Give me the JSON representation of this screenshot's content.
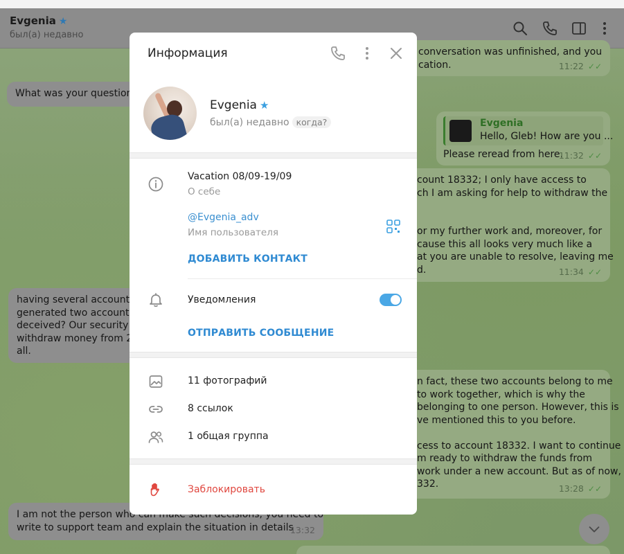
{
  "chat": {
    "contact_name": "Evgenia",
    "contact_status": "был(а) недавно",
    "messages": [
      {
        "lines": [
          "conversation was unfinished, and you",
          "cation."
        ],
        "time": "11:22"
      },
      {
        "lines": [
          "What was your question?"
        ]
      },
      {
        "reply_name": "Evgenia",
        "reply_text": "Hello, Gleb! How are you ...",
        "lines": [
          "Please reread from here."
        ],
        "time": "11:32"
      },
      {
        "lines": [
          "count 18332; I only have access to",
          "ch I am asking for help to withdraw the",
          "",
          "",
          "or my further work and, moreover, for",
          "cause this all looks very much like a",
          "at you are unable to resolve, leaving me",
          "d."
        ],
        "time": "11:34"
      },
      {
        "lines": [
          "having several accounts is",
          "generated two accounts a",
          "deceived? Our security tea",
          "withdraw money from 274",
          "all."
        ]
      },
      {
        "lines": [
          "n fact, these two accounts belong to me",
          "to work together, which is why the",
          "belonging to one person. However, this is",
          "ve mentioned this to you before.",
          "",
          "cess to account 18332. I want to continue",
          "m ready to withdraw the funds from",
          "work under a new account. But as of now,",
          "332."
        ],
        "time": "13:28"
      },
      {
        "lines": [
          "I am not the person who can make such decisions, you need to",
          "write to support team and explain the situation in details"
        ],
        "time": "13:32"
      }
    ]
  },
  "info": {
    "title": "Информация",
    "name": "Evgenia",
    "status": "был(а) недавно",
    "when_label": "когда?",
    "bio": "Vacation 08/09-19/09",
    "bio_label": "О себе",
    "username": "@Evgenia_adv",
    "username_label": "Имя пользователя",
    "add_contact": "ДОБАВИТЬ КОНТАКТ",
    "notifications_label": "Уведомления",
    "notifications_on": true,
    "send_message": "ОТПРАВИТЬ СООБЩЕНИЕ",
    "photos": "11 фотографий",
    "links": "8 ссылок",
    "groups": "1 общая группа",
    "block": "Заблокировать"
  },
  "icons": {
    "header": [
      "search-icon",
      "phone-icon",
      "sidebar-toggle-icon",
      "more-vertical-icon"
    ],
    "modal_header": [
      "phone-icon",
      "more-vertical-icon",
      "close-icon"
    ],
    "rows": [
      "info-icon",
      "bell-icon",
      "image-icon",
      "link-icon",
      "users-icon",
      "hand-icon"
    ]
  },
  "colors": {
    "accent": "#3a8fd0",
    "danger": "#e0473f",
    "star": "#3a9fe0",
    "toggle_on": "#4aa7e5"
  }
}
